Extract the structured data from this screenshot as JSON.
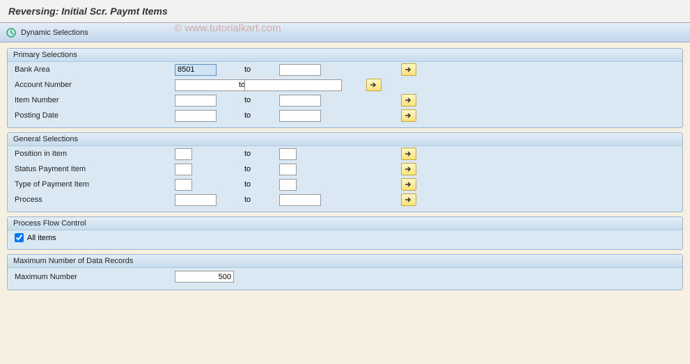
{
  "title": "Reversing: Initial Scr. Paymt Items",
  "toolbar": {
    "dynamic_selections": "Dynamic Selections"
  },
  "to_label": "to",
  "groups": {
    "primary": {
      "header": "Primary Selections",
      "rows": {
        "bank_area": {
          "label": "Bank Area",
          "from": "8501"
        },
        "account_number": {
          "label": "Account Number"
        },
        "item_number": {
          "label": "Item Number"
        },
        "posting_date": {
          "label": "Posting Date"
        }
      }
    },
    "general": {
      "header": "General Selections",
      "rows": {
        "position_in_item": {
          "label": "Position in Item"
        },
        "status_payment_item": {
          "label": "Status Payment Item"
        },
        "type_of_payment_item": {
          "label": "Type of Payment Item"
        },
        "process": {
          "label": "Process"
        }
      }
    },
    "flow": {
      "header": "Process Flow Control",
      "all_items": {
        "label": "All items",
        "checked": true
      }
    },
    "max": {
      "header": "Maximum Number of Data Records",
      "maximum_number": {
        "label": "Maximum Number",
        "value": "500"
      }
    }
  },
  "watermark": "© www.tutorialkart.com"
}
